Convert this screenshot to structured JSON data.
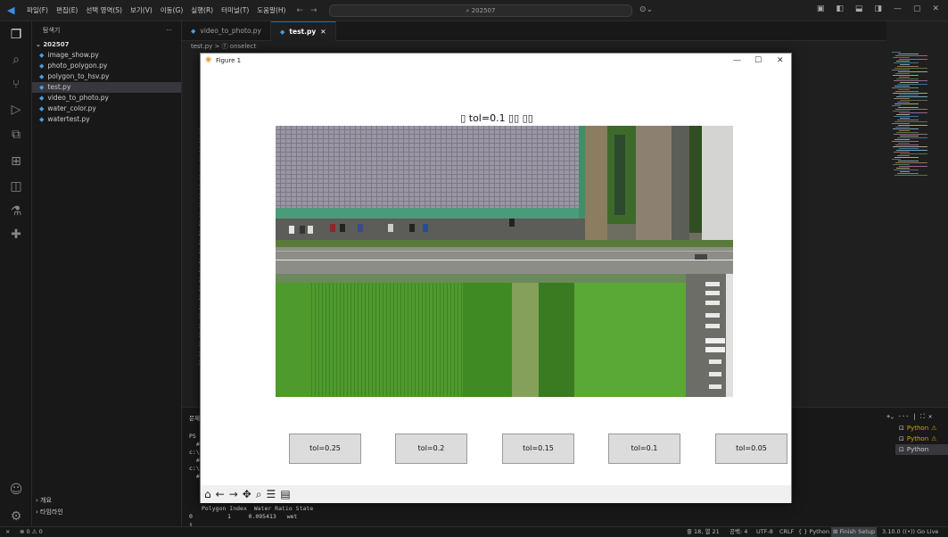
{
  "titlebar": {
    "menu": [
      "파일(F)",
      "편집(E)",
      "선택 영역(S)",
      "보기(V)",
      "이동(G)",
      "실행(R)",
      "터미널(T)",
      "도움말(H)"
    ],
    "search": "202507"
  },
  "sidebar": {
    "title": "탐색기",
    "folder": "202507",
    "files": [
      "image_show.py",
      "photo_polygon.py",
      "polygon_to_hsv.py",
      "test.py",
      "video_to_photo.py",
      "water_color.py",
      "watertest.py"
    ],
    "selected_file": "test.py",
    "outline": "개요",
    "timeline": "타임라인"
  },
  "tabs": [
    {
      "label": "video_to_photo.py",
      "active": false
    },
    {
      "label": "test.py",
      "active": true
    }
  ],
  "breadcrumb": "test.py > ⓕ onselect",
  "editor": {
    "line_numbers": [
      "2",
      "3",
      "4",
      "5",
      "6",
      "7",
      "8",
      "9",
      "10",
      "11",
      "12",
      "13",
      "14",
      "15",
      "16",
      "17",
      "18",
      "19",
      "20",
      "21",
      "22",
      "23",
      "24",
      "25",
      "26",
      "27",
      "28",
      "29",
      "30",
      "31",
      "32",
      "33",
      "34",
      "35"
    ]
  },
  "figure": {
    "window_title": "Figure 1",
    "plot_title": "▯ tol=0.1 ▯▯ ▯▯",
    "buttons": [
      "tol=0.25",
      "tol=0.2",
      "tol=0.15",
      "tol=0.1",
      "tol=0.05"
    ]
  },
  "panel": {
    "tab_label": "문제",
    "lines": [
      "PS",
      "  #",
      "c:\\",
      "  #",
      "c:\\",
      "  #"
    ],
    "table_header": "Polygon Index  Water Ratio State",
    "table_row": "0          1     0.095413   wet"
  },
  "terminals": [
    "Python",
    "Python",
    "Python"
  ],
  "statusbar": {
    "left": "⊗ 0 ⚠ 0",
    "position": "줄 18, 열 21",
    "spaces": "공백: 4",
    "encoding": "UTF-8",
    "eol": "CRLF",
    "language": "{ } Python",
    "finish_setup": "Finish Setup",
    "version": "3.10.0",
    "golive": "Go Live"
  },
  "colors": {
    "accent": "#0078d4",
    "figure_bg": "#ffffff",
    "button_bg": "#dcdcdc"
  }
}
